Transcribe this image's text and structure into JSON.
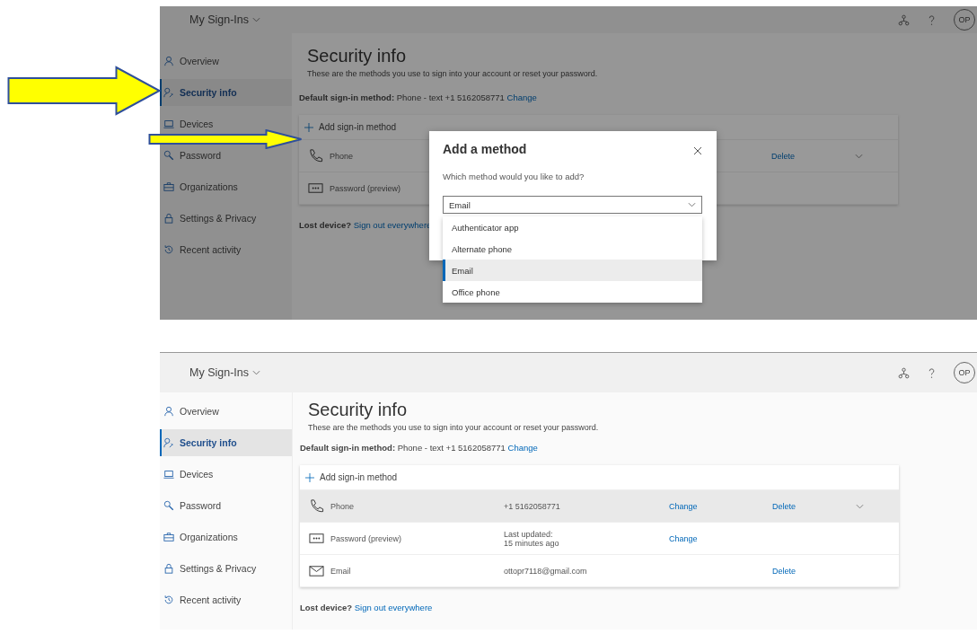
{
  "screenshots": [
    {
      "dimmed": true,
      "app_title": "My Sign-Ins",
      "avatar": "OP",
      "sidebar": [
        {
          "label": "Overview",
          "selected": false
        },
        {
          "label": "Security info",
          "selected": true
        },
        {
          "label": "Devices",
          "selected": false
        },
        {
          "label": "Password",
          "selected": false
        },
        {
          "label": "Organizations",
          "selected": false
        },
        {
          "label": "Settings & Privacy",
          "selected": false
        },
        {
          "label": "Recent activity",
          "selected": false
        }
      ],
      "title": "Security info",
      "subtitle": "These are the methods you use to sign into your account or reset your password.",
      "default_label": "Default sign-in method:",
      "default_value": "Phone - text +1 5162058771",
      "default_link": "Change",
      "add_label": "Add sign-in method",
      "methods": [
        {
          "kind": "phone",
          "label": "Phone",
          "delete": "Delete",
          "expandable": true
        },
        {
          "kind": "password",
          "label": "Password (preview)",
          "expandable": false
        }
      ],
      "lost_label": "Lost device?",
      "lost_link": "Sign out everywhere",
      "dialog": {
        "title": "Add a method",
        "prompt": "Which method would you like to add?",
        "value": "Email",
        "options": [
          {
            "label": "Authenticator app",
            "selected": false
          },
          {
            "label": "Alternate phone",
            "selected": false
          },
          {
            "label": "Email",
            "selected": true
          },
          {
            "label": "Office phone",
            "selected": false
          }
        ]
      }
    },
    {
      "dimmed": false,
      "app_title": "My Sign-Ins",
      "avatar": "OP",
      "sidebar": [
        {
          "label": "Overview",
          "selected": false
        },
        {
          "label": "Security info",
          "selected": true
        },
        {
          "label": "Devices",
          "selected": false
        },
        {
          "label": "Password",
          "selected": false
        },
        {
          "label": "Organizations",
          "selected": false
        },
        {
          "label": "Settings & Privacy",
          "selected": false
        },
        {
          "label": "Recent activity",
          "selected": false
        }
      ],
      "title": "Security info",
      "subtitle": "These are the methods you use to sign into your account or reset your password.",
      "default_label": "Default sign-in method:",
      "default_value": "Phone - text +1 5162058771",
      "default_link": "Change",
      "add_label": "Add sign-in method",
      "methods": [
        {
          "kind": "phone",
          "label": "Phone",
          "value": "+1 5162058771",
          "change": "Change",
          "delete": "Delete",
          "expandable": true,
          "highlighted": true
        },
        {
          "kind": "password",
          "label": "Password (preview)",
          "value": "Last updated:",
          "value_2": "15 minutes ago",
          "change": "Change",
          "highlighted": false,
          "expandable": false
        },
        {
          "kind": "email",
          "label": "Email",
          "value": "ottopr7118@gmail.com",
          "delete": "Delete",
          "highlighted": false,
          "expandable": false
        }
      ],
      "lost_label": "Lost device?",
      "lost_link": "Sign out everywhere"
    }
  ]
}
